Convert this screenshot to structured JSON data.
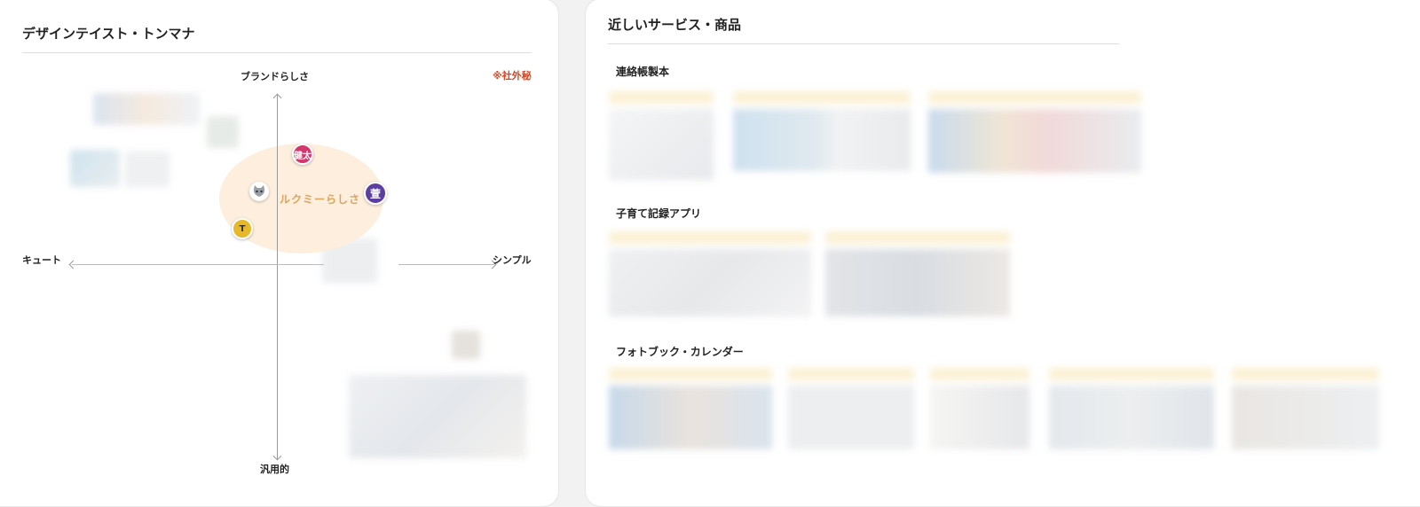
{
  "left_panel": {
    "title": "デザインテイスト・トンマナ",
    "confidential": "※社外秘",
    "axes": {
      "top": "ブランドらしさ",
      "bottom": "汎用的",
      "left": "キュート",
      "right": "シンプル"
    },
    "highlight_label": "ルクミーらしさ",
    "avatars": [
      {
        "label": "健太",
        "color": "#d3376d"
      },
      {
        "label": "萱",
        "color": "#5b3fa0"
      },
      {
        "label": "T",
        "color": "#e7b82a"
      },
      {
        "label": "",
        "color": "#ffffff"
      }
    ]
  },
  "right_panel": {
    "title": "近しいサービス・商品",
    "sections": [
      {
        "title": "連絡帳製本"
      },
      {
        "title": "子育て記録アプリ"
      },
      {
        "title": "フォトブック・カレンダー"
      }
    ]
  }
}
